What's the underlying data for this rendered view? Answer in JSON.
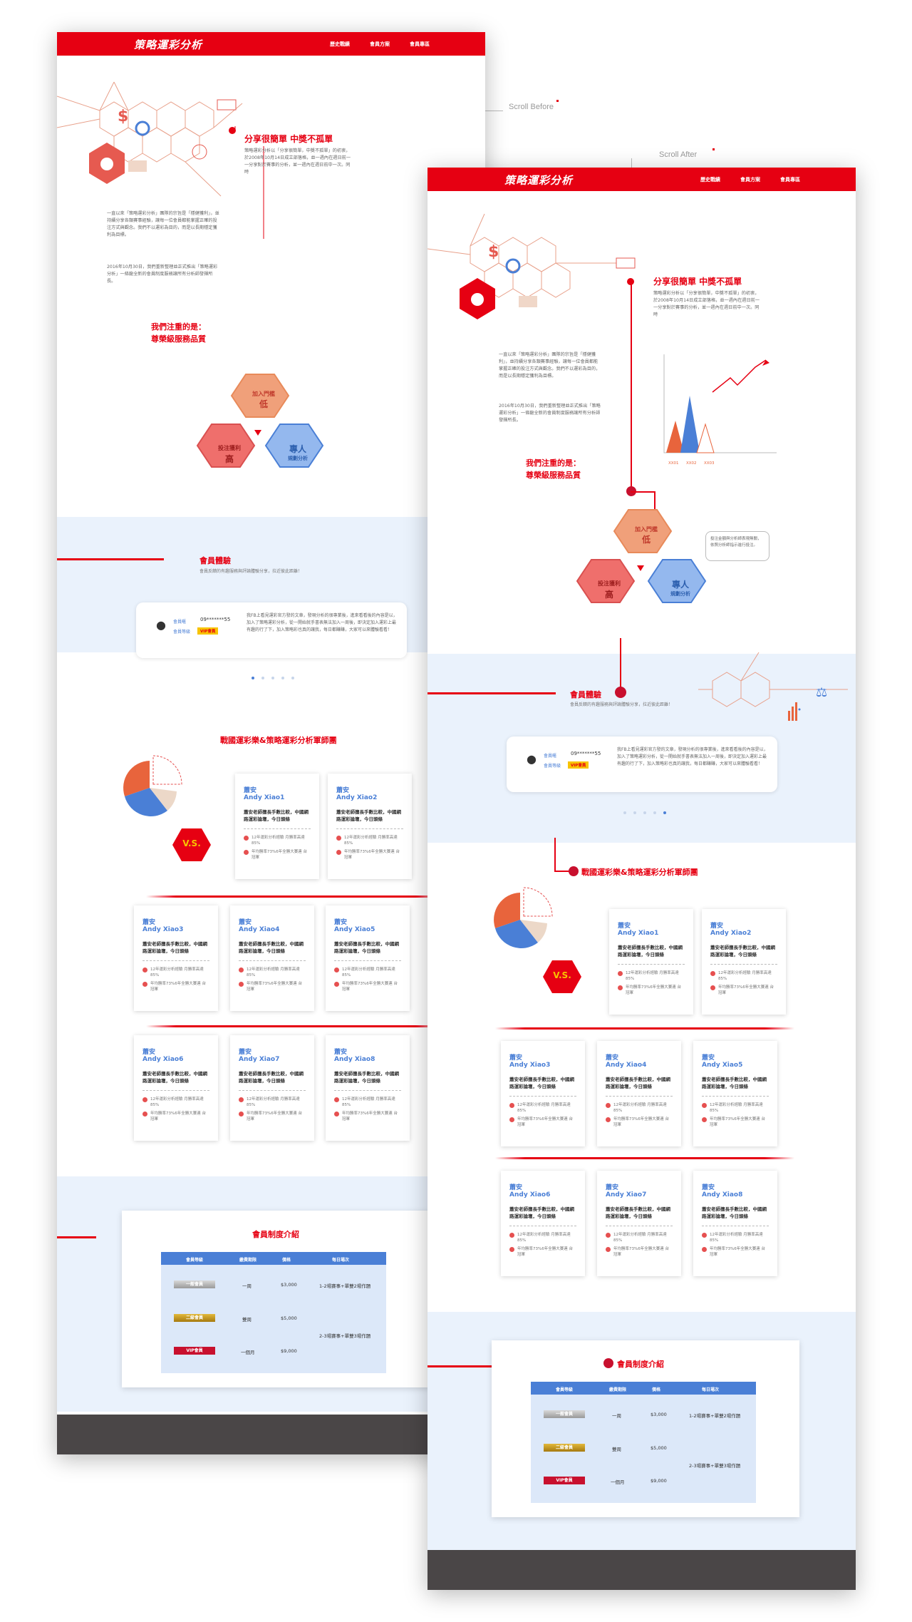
{
  "labels": {
    "scroll_before": "Scroll Before",
    "scroll_after": "Scroll After"
  },
  "nav": {
    "logo": "策略運彩分析",
    "links": [
      "歷史戰績",
      "會員方案",
      "會員專區"
    ]
  },
  "hero": {
    "title": "分享很簡單 中獎不孤單",
    "intro": "策略運彩分析以「分享很簡單，中獎不孤單」的初衷，於2008年10月14日成立部落格，並一週內在週日前一一分享對於賽事的分析，並一週內在週日前中一次。同時",
    "body": "一直以來「策略運彩分析」團隊的宗旨是「穩健獲利」，並持續分享各類賽事經驗，讓每一位會員都能掌握正確的投注方式與觀念。我們不以運彩為目的，而是以長期穩定獲利為目標。",
    "body2": "2016年10月30日，我們重新整理並正式推出「策略運彩分析」一條龍全新的會員制度服務讓所有分析師發揮所長。",
    "chart_labels": [
      "XX01",
      "XX02",
      "XX03"
    ],
    "note": "投注金額與分析師表現無關，依照分析師指示進行投注。"
  },
  "quality": {
    "line1": "我們注重的是：",
    "line2": "尊榮級服務品質"
  },
  "hexes": {
    "join_top": "加入門檻",
    "join_val": "低",
    "profit_top": "投注獲利",
    "profit_val": "高",
    "expert_top": "專人",
    "expert_val": "規劃分析"
  },
  "experience": {
    "title": "會員體驗",
    "subtitle": "會員反饋的有趣服務與評論體驗分享，拉近彼此距離！",
    "nick_label": "會員暱",
    "nick_value": "09*******55",
    "level_label": "會員等級",
    "level_value": "VIP會員",
    "text": "我FB上看見運彩官方發的文章，發現分析的很專業後，進來看看後的內容是以，加入了策略運彩分析，從一開始就手書表無法加入一周後，即決定加入運彩上最有趣的行了下，加入策略彩也真的讓我，每日都賺賺，大家可以來體驗看看！"
  },
  "analysts": {
    "title": "戰國運彩樂&策略運彩分析軍師團",
    "vs": "V.S.",
    "cards": [
      {
        "cn": "蕭安",
        "en": "Andy Xiao1"
      },
      {
        "cn": "蕭安",
        "en": "Andy Xiao2"
      },
      {
        "cn": "蕭安",
        "en": "Andy Xiao3"
      },
      {
        "cn": "蕭安",
        "en": "Andy Xiao4"
      },
      {
        "cn": "蕭安",
        "en": "Andy Xiao5"
      },
      {
        "cn": "蕭安",
        "en": "Andy Xiao6"
      },
      {
        "cn": "蕭安",
        "en": "Andy Xiao7"
      },
      {
        "cn": "蕭安",
        "en": "Andy Xiao8"
      }
    ],
    "desc": "蕭安老師擅長手數比較，中國網路運彩論壇，今日頭條",
    "b1": "12年運彩分析經驗 月勝率高達85%",
    "b2": "年均勝率73%6年全勝大賽連 台冠軍"
  },
  "membership": {
    "title": "會員制度介紹",
    "headers": [
      "會員等級",
      "繳費期限",
      "價格",
      "每日場次"
    ],
    "rows": [
      {
        "tier": "一般會員",
        "period": "一周",
        "price": "$3,000"
      },
      {
        "tier": "二級會員",
        "period": "雙周",
        "price": "$5,000"
      },
      {
        "tier": "VIP會員",
        "period": "一個月",
        "price": "$9,000"
      }
    ],
    "games1": "1-2場賽事+單雙2場作題",
    "games2": "2-3場賽事+單雙3場作題"
  },
  "colors": {
    "brand": "#e60012",
    "blue": "#4a7fd6",
    "footer": "#4a4647"
  }
}
